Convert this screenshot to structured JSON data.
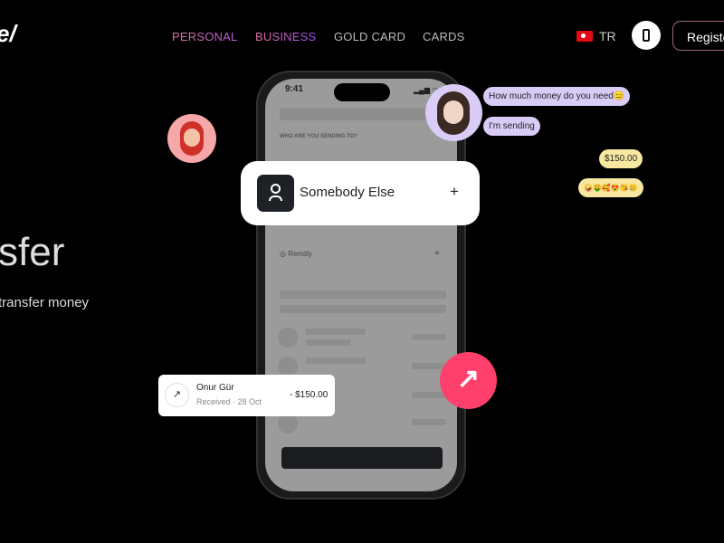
{
  "brand": {
    "logo": "e/"
  },
  "nav": {
    "items": [
      {
        "label": "PERSONAL"
      },
      {
        "label": "BUSINESS"
      },
      {
        "label": "GOLD CARD"
      },
      {
        "label": "CARDS"
      }
    ]
  },
  "header": {
    "language": "TR",
    "register": "Registe"
  },
  "hero": {
    "title": "sfer",
    "subtitle": "transfer money"
  },
  "phone": {
    "time": "9:41",
    "section_label": "WHO ARE YOU SENDING TO?",
    "remitly": "Remitly",
    "remitly_action": "+"
  },
  "recipient_card": {
    "label": "Somebody Else",
    "action": "+"
  },
  "chat": {
    "messages": [
      "How much money do you need😑",
      "I'm sending"
    ],
    "replies": [
      "$150.00",
      "🤪🤑🥰😍😘🥲"
    ]
  },
  "transaction": {
    "name": "Onur Gür",
    "status": "Received · 28 Oct",
    "amount": "- $150.00"
  },
  "colors": {
    "accent": "#ff3f6c",
    "chat_purple": "#d8ccf7",
    "chat_yellow": "#f7e7a0"
  }
}
